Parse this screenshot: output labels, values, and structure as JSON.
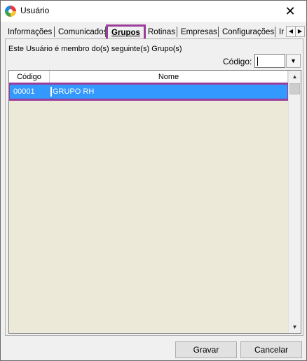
{
  "window": {
    "title": "Usuário",
    "close_glyph": "✕"
  },
  "tabs": [
    {
      "label": "Informações"
    },
    {
      "label": "Comunicados"
    },
    {
      "label": "Grupos",
      "active": true
    },
    {
      "label": "Rotinas"
    },
    {
      "label": "Empresas"
    },
    {
      "label": "Configurações"
    },
    {
      "label": "Ir"
    }
  ],
  "panel": {
    "info_text": "Este Usuário é membro do(s) seguinte(s) Grupo(s)",
    "code_label": "Código:",
    "code_value": ""
  },
  "grid": {
    "columns": [
      {
        "label": "Código"
      },
      {
        "label": "Nome"
      }
    ],
    "rows": [
      {
        "code": "00001",
        "name": "GRUPO RH",
        "selected": true
      }
    ]
  },
  "buttons": {
    "save_label": "Gravar",
    "cancel_label": "Cancelar"
  },
  "colors": {
    "accent_highlight": "#9b3d9b",
    "selection": "#3399ff"
  },
  "icons": {
    "app": "app-logo-icon",
    "scroll_up": "scroll-up-icon",
    "scroll_down": "scroll-down-icon",
    "dropdown": "chevron-down-icon"
  }
}
